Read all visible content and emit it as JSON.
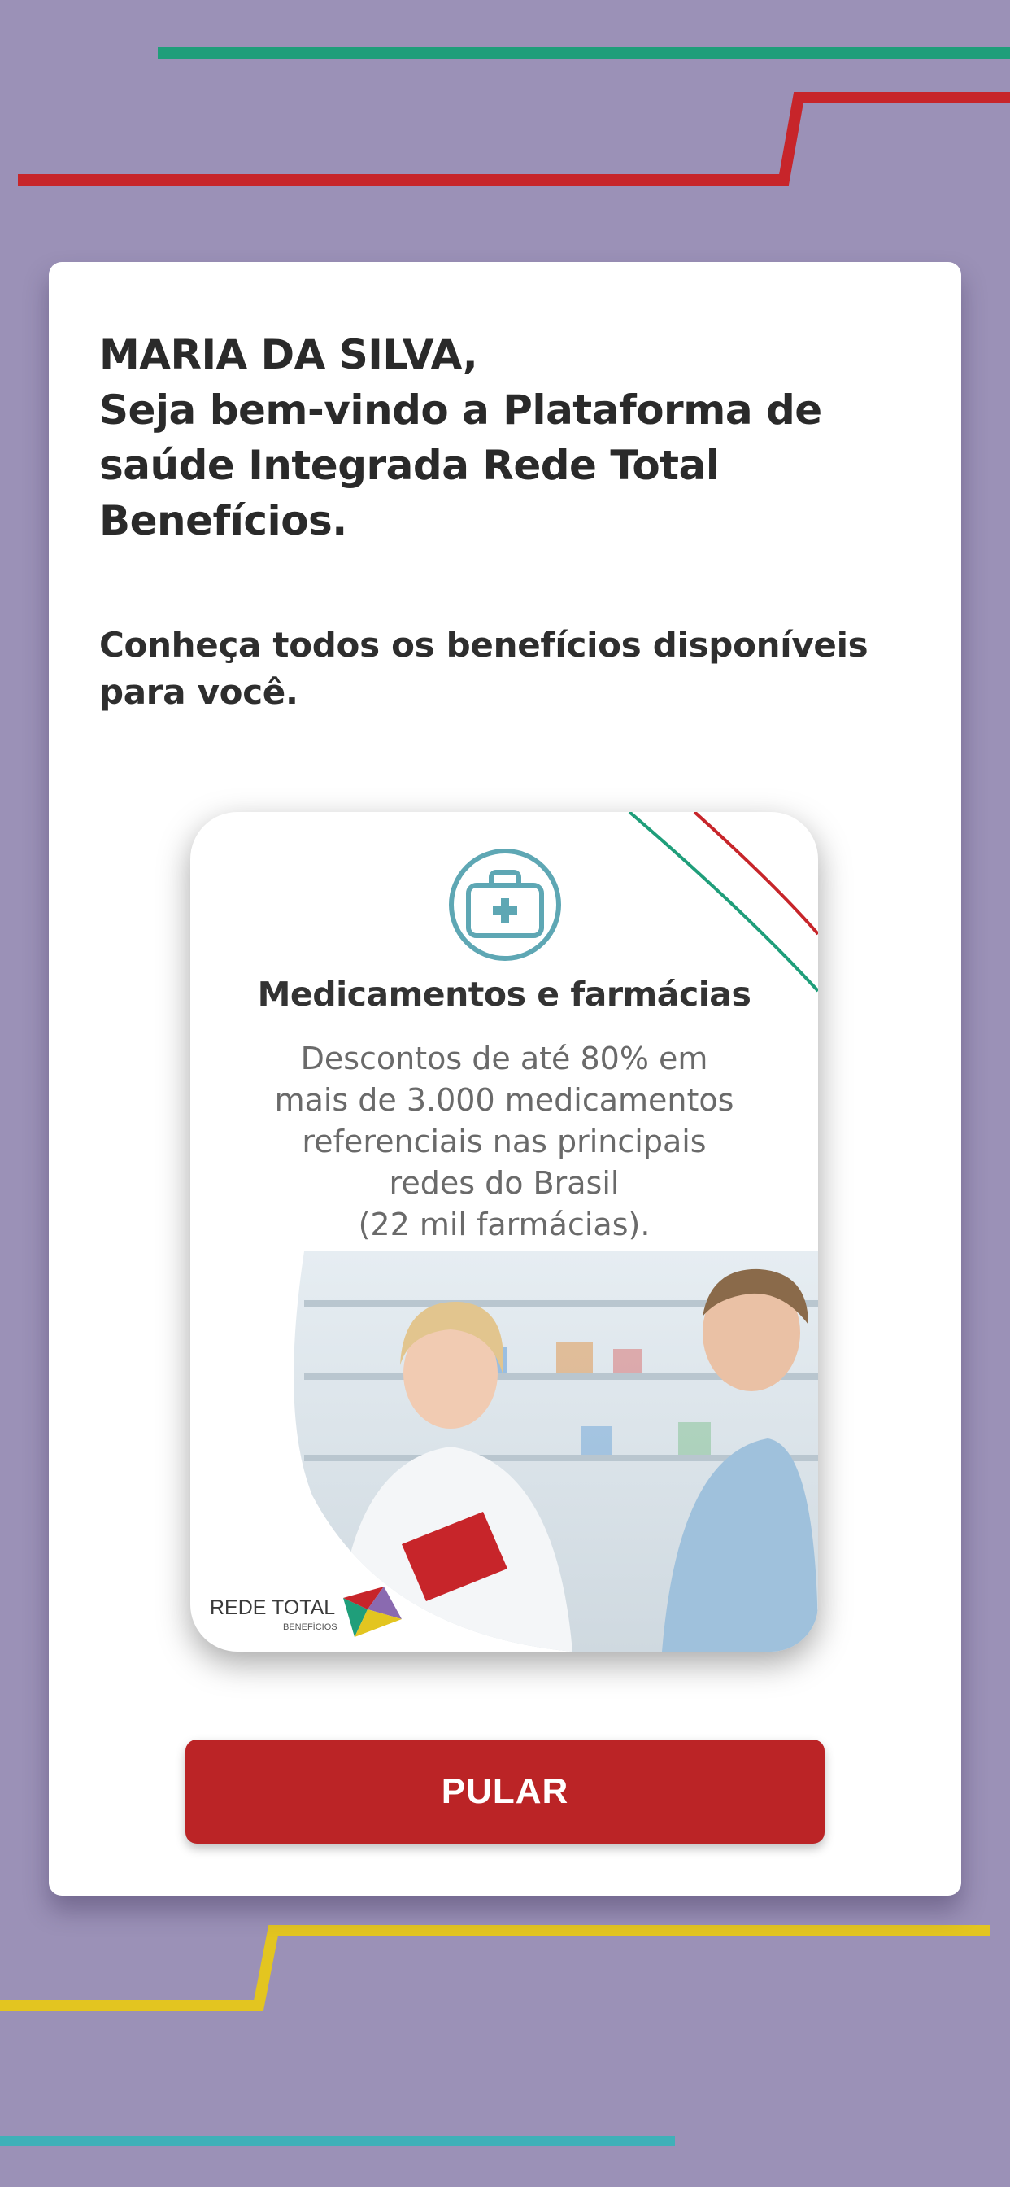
{
  "colors": {
    "background": "#9b91b7",
    "accent_green": "#1f9e7a",
    "accent_red": "#c7252a",
    "accent_yellow": "#e3c520",
    "accent_teal": "#3fb0b8",
    "button": "#bb2426"
  },
  "welcome": {
    "name_line": "MARIA DA SILVA,",
    "message_lines": [
      "Seja bem-vindo a Plataforma de",
      "saúde Integrada Rede Total",
      "Benefícios."
    ]
  },
  "subtitle_lines": [
    "Conheça todos os benefícios disponíveis",
    "para você."
  ],
  "promo": {
    "icon": "medical-kit-icon",
    "title": "Medicamentos e farmácias",
    "description_lines": [
      "Descontos de até 80% em",
      "mais de 3.000 medicamentos",
      "referenciais nas principais",
      "redes do Brasil",
      "(22 mil farmácias)."
    ],
    "logo_text": "REDE TOTAL",
    "logo_subtext": "BENEFÍCIOS"
  },
  "skip_button": {
    "label": "PULAR"
  }
}
